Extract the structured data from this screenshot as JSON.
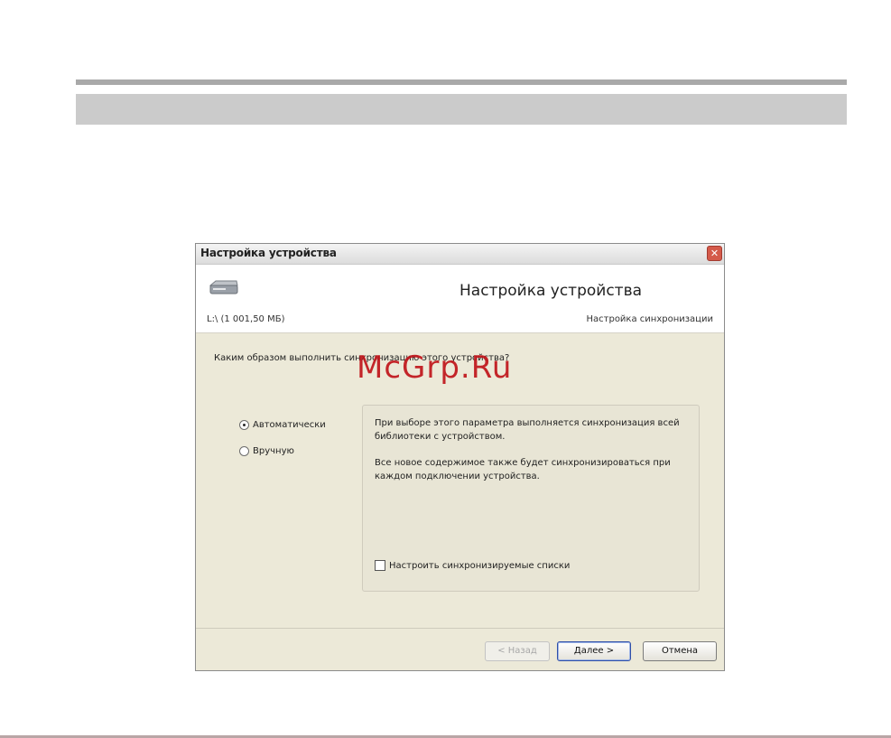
{
  "dialog": {
    "title": "Настройка устройства",
    "close_glyph": "✕",
    "header_title": "Настройка устройства",
    "device_info": "L:\\ (1 001,50 МБ)",
    "subtitle": "Настройка синхронизации",
    "question": "Каким образом выполнить синхронизацию этого устройства?",
    "options": {
      "auto_label": "Автоматически",
      "manual_label": "Вручную",
      "selected": "auto"
    },
    "info": {
      "paragraph1": "При выборе этого параметра выполняется синхронизация всей библиотеки с устройством.",
      "paragraph2": "Все новое содержимое также будет синхронизироваться при каждом подключении устройства.",
      "checkbox_label": "Настроить синхронизируемые списки",
      "checkbox_checked": false
    },
    "buttons": {
      "back": "< Назад",
      "next": "Далее >",
      "cancel": "Отмена"
    }
  },
  "watermark": "McGrp.Ru",
  "icons": {
    "device": "hard-drive-icon",
    "close": "close-icon"
  },
  "colors": {
    "watermark": "#c0151b",
    "close_button": "#d45a4a",
    "default_button_border": "#2f4fa8"
  }
}
